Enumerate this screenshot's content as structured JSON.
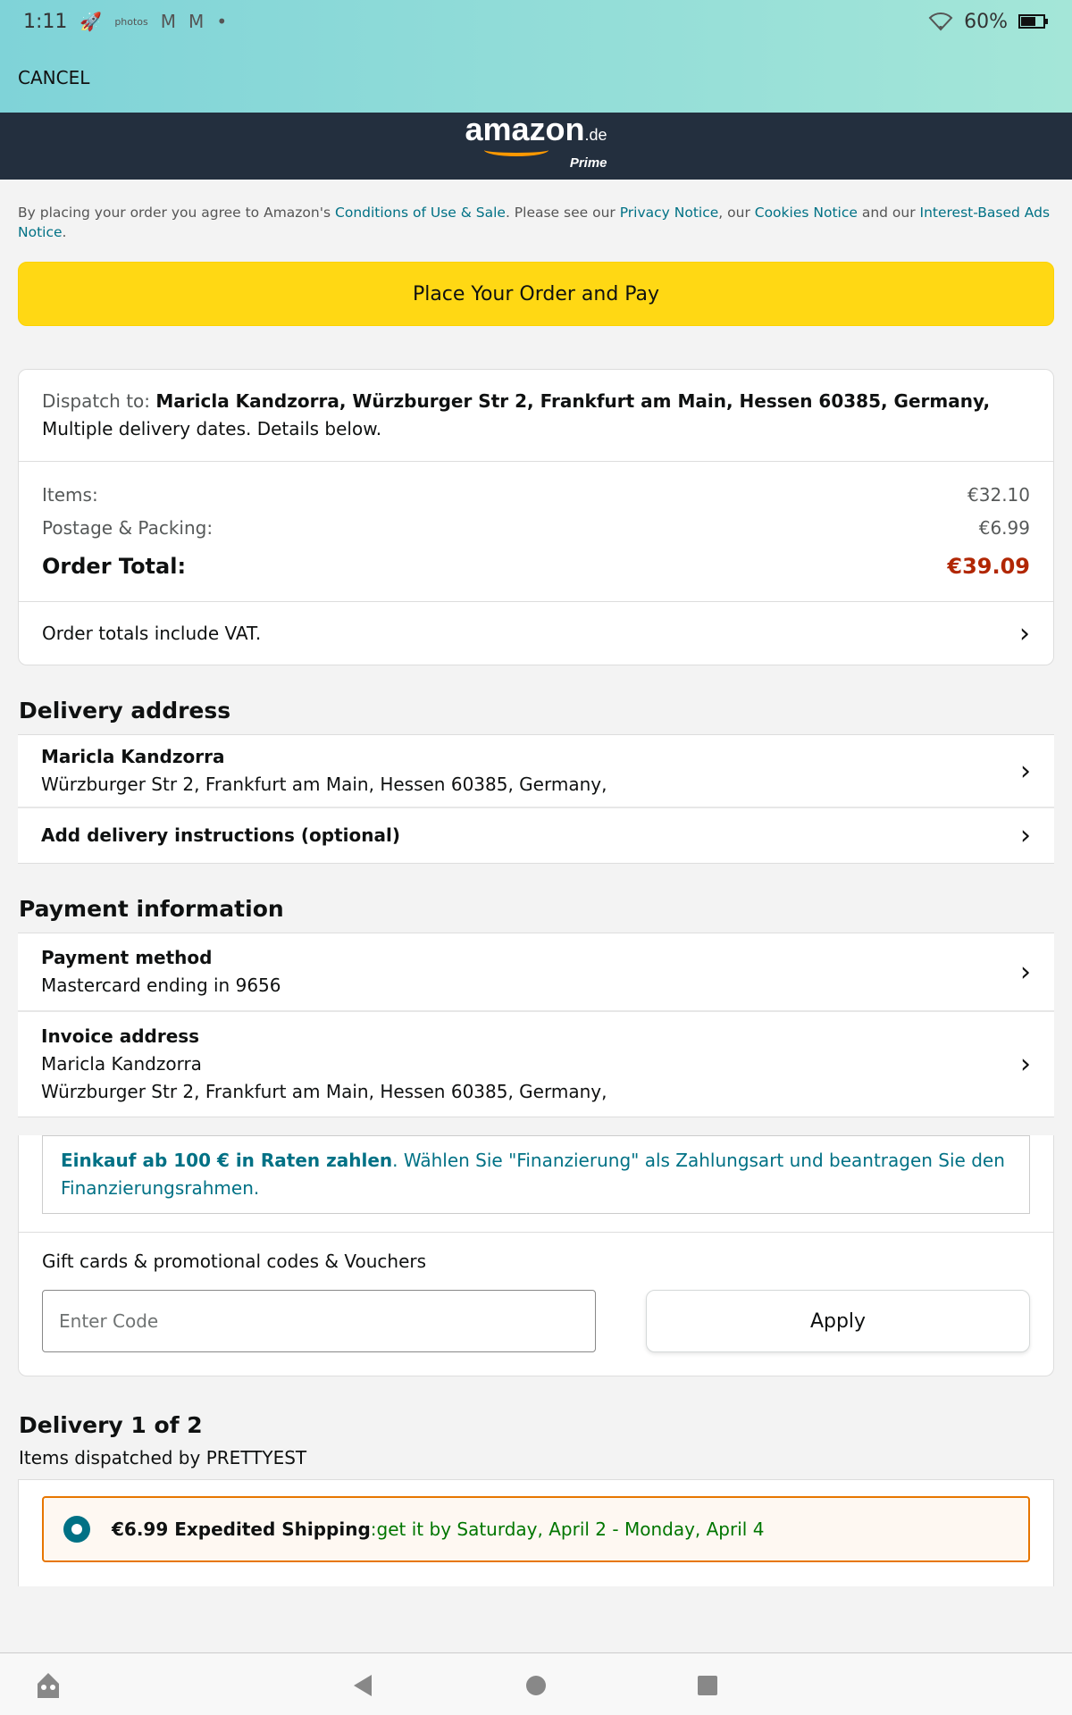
{
  "status": {
    "time": "1:11",
    "battery": "60%",
    "notif_icons": [
      "rocket-icon",
      "photos-icon",
      "gmail-icon",
      "gmail-icon",
      "dot-icon"
    ]
  },
  "header": {
    "cancel": "CANCEL"
  },
  "brand": {
    "logo": "amazon",
    "tld": ".de",
    "prime": "Prime"
  },
  "legal": {
    "t1": "By placing your order you agree to Amazon's ",
    "l1": "Conditions of Use & Sale",
    "t2": ". Please see our ",
    "l2": "Privacy Notice",
    "t3": ", our ",
    "l3": "Cookies Notice",
    "t4": " and our ",
    "l4": "Interest-Based Ads Notice",
    "t5": "."
  },
  "place_order": "Place Your Order and Pay",
  "summary": {
    "dispatch_label": "Dispatch to: ",
    "dispatch_address": "Maricla Kandzorra, Würzburger Str 2, Frankfurt am Main, Hessen 60385, Germany,",
    "dispatch_note": " Multiple delivery dates. Details below.",
    "items_label": "Items:",
    "items_value": "€32.10",
    "postage_label": "Postage & Packing:",
    "postage_value": "€6.99",
    "total_label": "Order Total:",
    "total_value": "€39.09",
    "vat_note": "Order totals include VAT."
  },
  "delivery_address": {
    "title": "Delivery address",
    "name": "Maricla Kandzorra",
    "address": "Würzburger Str 2, Frankfurt am Main, Hessen 60385, Germany,",
    "instructions": "Add delivery instructions (optional)"
  },
  "payment": {
    "title": "Payment information",
    "method_label": "Payment method",
    "method_value": "Mastercard ending in 9656",
    "invoice_label": "Invoice address",
    "invoice_name": "Maricla Kandzorra",
    "invoice_address": "Würzburger Str 2, Frankfurt am Main, Hessen 60385, Germany,",
    "finance_bold": "Einkauf ab 100 € in Raten zahlen",
    "finance_text": ". Wählen Sie \"Finanzierung\" als Zahlungsart und beantragen Sie den Finanzierungsrahmen.",
    "gift_label": "Gift cards & promotional codes & Vouchers",
    "code_placeholder": "Enter Code",
    "apply": "Apply"
  },
  "delivery": {
    "title": "Delivery 1 of 2",
    "subtitle": "Items dispatched by PRETTYEST",
    "option_price": "€6.99 Expedited Shipping",
    "option_sep": " : ",
    "option_date": "get it by Saturday, April 2 - Monday, April 4"
  }
}
